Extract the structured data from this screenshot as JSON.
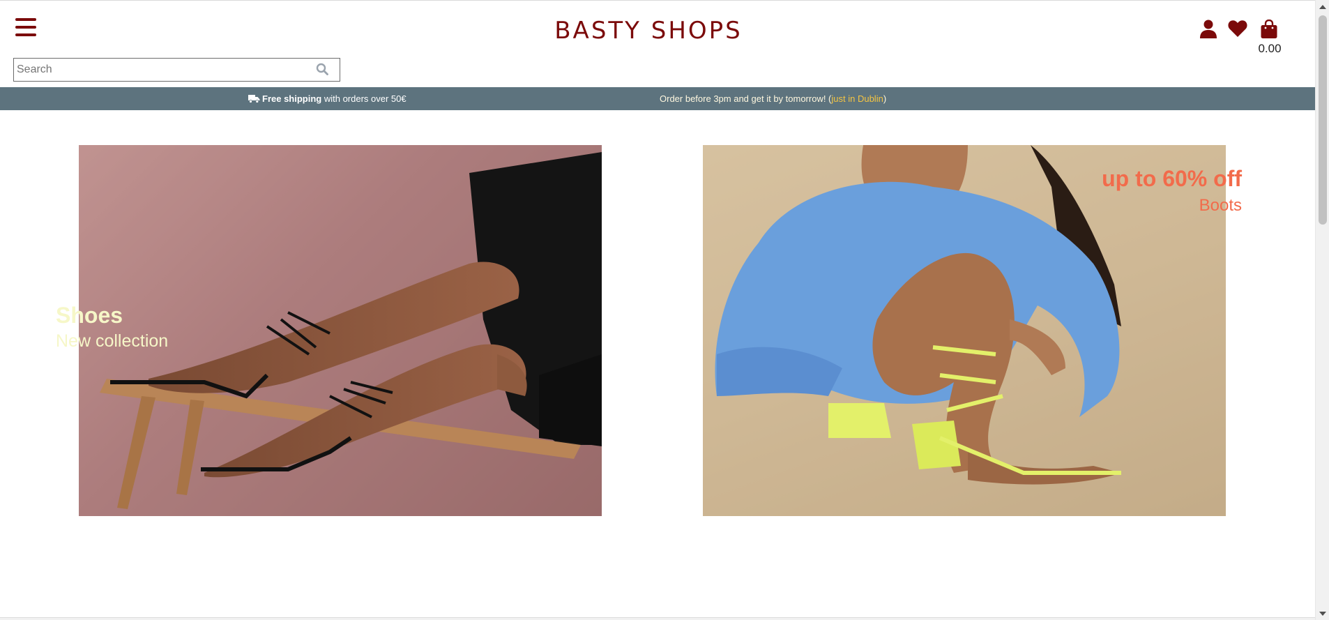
{
  "brand": {
    "title": "BASTY SHOPS",
    "color": "#7b0a0a"
  },
  "search": {
    "placeholder": "Search",
    "value": ""
  },
  "header_icons": {
    "user": "user-icon",
    "wishlist": "heart-icon",
    "cart": "shopping-bag-icon"
  },
  "cart": {
    "total": "0.00"
  },
  "promo_bar": {
    "shipping_bold": "Free shipping",
    "shipping_rest": " with orders over 50€",
    "delivery_text": "Order before 3pm and get it by tomorrow! (",
    "delivery_highlight": "just in Dublin",
    "delivery_close": ")",
    "background": "#5d737e"
  },
  "banners": [
    {
      "title": "Shoes",
      "subtitle": "New collection",
      "text_color": "#f6f7c8"
    },
    {
      "title": "up to 60% off",
      "subtitle": "Boots",
      "text_color": "#f26b4b"
    }
  ]
}
